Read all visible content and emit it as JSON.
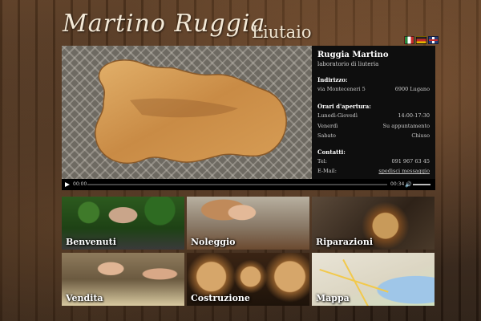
{
  "header": {
    "logo_script": "Martino Ruggia",
    "logo_sub": "Liutaio",
    "flags": [
      "it-flag-icon",
      "de-flag-icon",
      "en-flag-icon"
    ]
  },
  "info": {
    "name": "Ruggia Martino",
    "tagline": "laboratorio di liuteria",
    "address_label": "Indirizzo:",
    "address_street": "via Monteceneri 5",
    "address_city": "6900 Lugano",
    "hours_label": "Orari d'apertura:",
    "hours": [
      {
        "day": "Lunedì-Giovedì",
        "time": "14:00-17:30"
      },
      {
        "day": "Venerdì",
        "time": "Su appuntamento"
      },
      {
        "day": "Sabato",
        "time": "Chiuso"
      }
    ],
    "contacts_label": "Contatti:",
    "tel_label": "Tel:",
    "tel_value": "091 967 63 45",
    "email_label": "E-Mail:",
    "email_link": "spedisci messaggio"
  },
  "player": {
    "current_time": "00:00",
    "duration": "00:34",
    "progress": 0,
    "volume": 0.8
  },
  "tiles": [
    {
      "id": "benvenuti",
      "label": "Benvenuti"
    },
    {
      "id": "noleggio",
      "label": "Noleggio"
    },
    {
      "id": "riparazioni",
      "label": "Riparazioni"
    },
    {
      "id": "vendita",
      "label": "Vendita"
    },
    {
      "id": "costruzione",
      "label": "Costruzione"
    },
    {
      "id": "mappa",
      "label": "Mappa"
    }
  ],
  "colors": {
    "info_bg": "#0e0e0e",
    "text_light": "#f4ead8"
  }
}
